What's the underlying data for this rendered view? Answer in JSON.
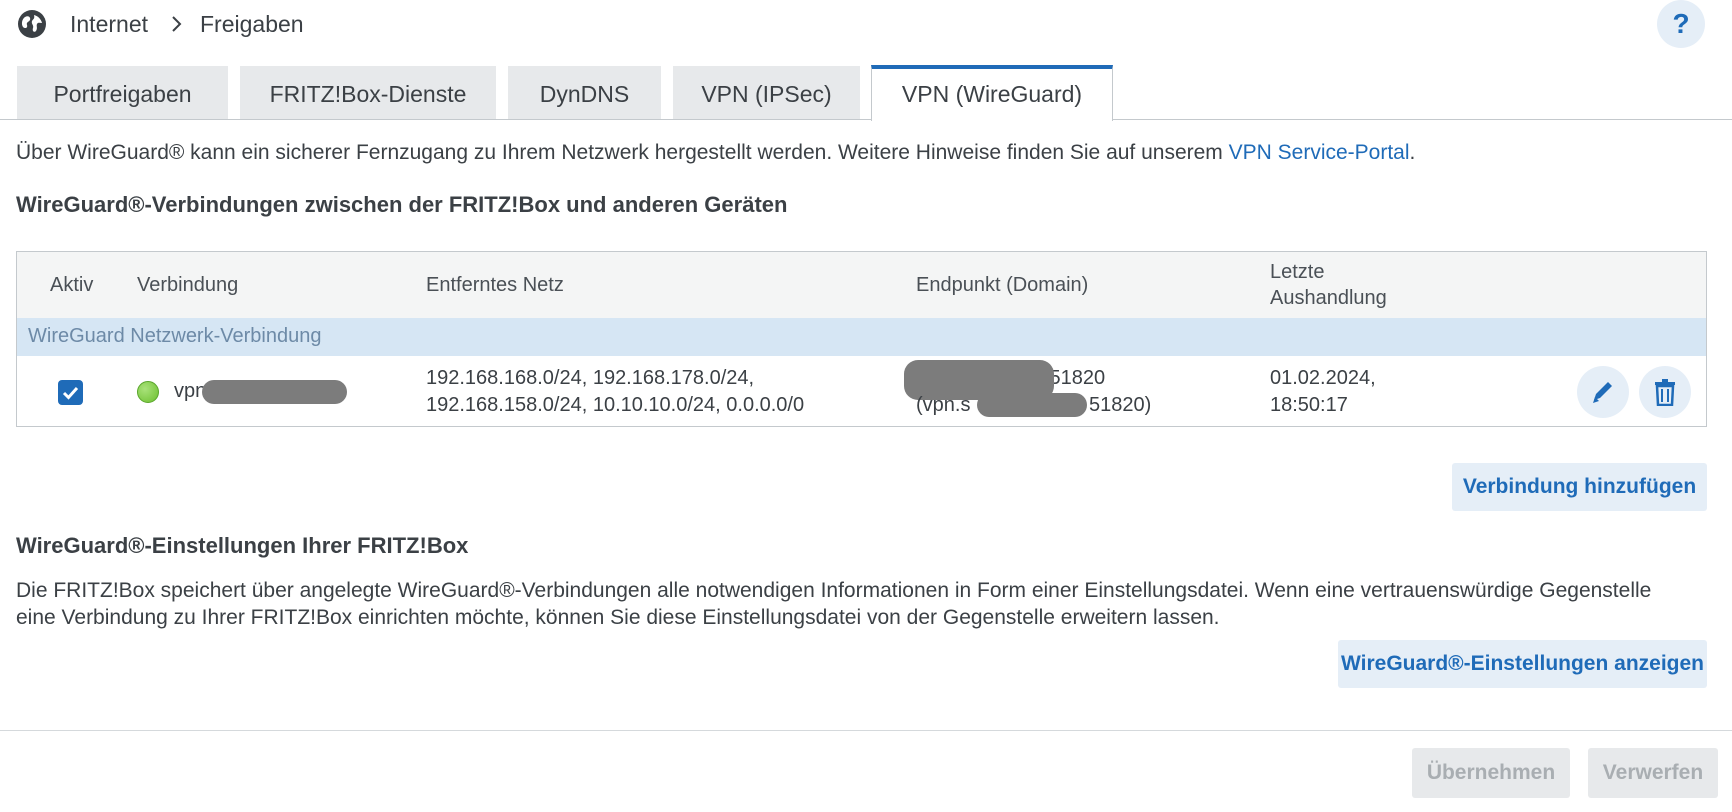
{
  "breadcrumb": {
    "level1": "Internet",
    "level2": "Freigaben",
    "help": "?"
  },
  "tabs": [
    {
      "label": "Portfreigaben"
    },
    {
      "label": "FRITZ!Box-Dienste"
    },
    {
      "label": "DynDNS"
    },
    {
      "label": "VPN (IPSec)"
    },
    {
      "label": "VPN (WireGuard)",
      "active": true
    }
  ],
  "intro": {
    "text": "Über WireGuard® kann ein sicherer Fernzugang zu Ihrem Netzwerk hergestellt werden. Weitere Hinweise finden Sie auf unserem ",
    "link": "VPN Service-Portal",
    "end": "."
  },
  "connections": {
    "heading": "WireGuard®-Verbindungen zwischen der FRITZ!Box und anderen Geräten",
    "columns": {
      "active": "Aktiv",
      "connection": "Verbindung",
      "remote_net": "Entferntes Netz",
      "endpoint": "Endpunkt (Domain)",
      "last_line1": "Letzte",
      "last_line2": "Aushandlung"
    },
    "group_label": "WireGuard Netzwerk-Verbindung",
    "rows": [
      {
        "active": true,
        "status_color": "#6cbf2f",
        "name_visible": "vpn",
        "remote_line1": "192.168.168.0/24, 192.168.178.0/24,",
        "remote_line2": "192.168.158.0/24, 10.10.10.0/24, 0.0.0.0/0",
        "endpoint_line1_visible": ":51820",
        "endpoint_line2_prefix": "(vpn.s",
        "endpoint_line2_suffix": "51820)",
        "date": "01.02.2024,",
        "time": "18:50:17"
      }
    ],
    "add_button": "Verbindung hinzufügen"
  },
  "settings": {
    "heading": "WireGuard®-Einstellungen Ihrer FRITZ!Box",
    "text": "Die FRITZ!Box speichert über angelegte WireGuard®-Verbindungen alle notwendigen Informationen in Form einer Einstellungsdatei. Wenn eine vertrauenswürdige Gegenstelle eine Verbindung zu Ihrer FRITZ!Box einrichten möchte, können Sie diese Einstellungsdatei von der Gegenstelle erweitern lassen.",
    "show_button": "WireGuard®-Einstellungen anzeigen"
  },
  "footer": {
    "apply": "Übernehmen",
    "discard": "Verwerfen"
  },
  "colors": {
    "accent": "#1f6bb8",
    "group_row": "#d6e6f4",
    "button_bg": "#e5eef7"
  }
}
